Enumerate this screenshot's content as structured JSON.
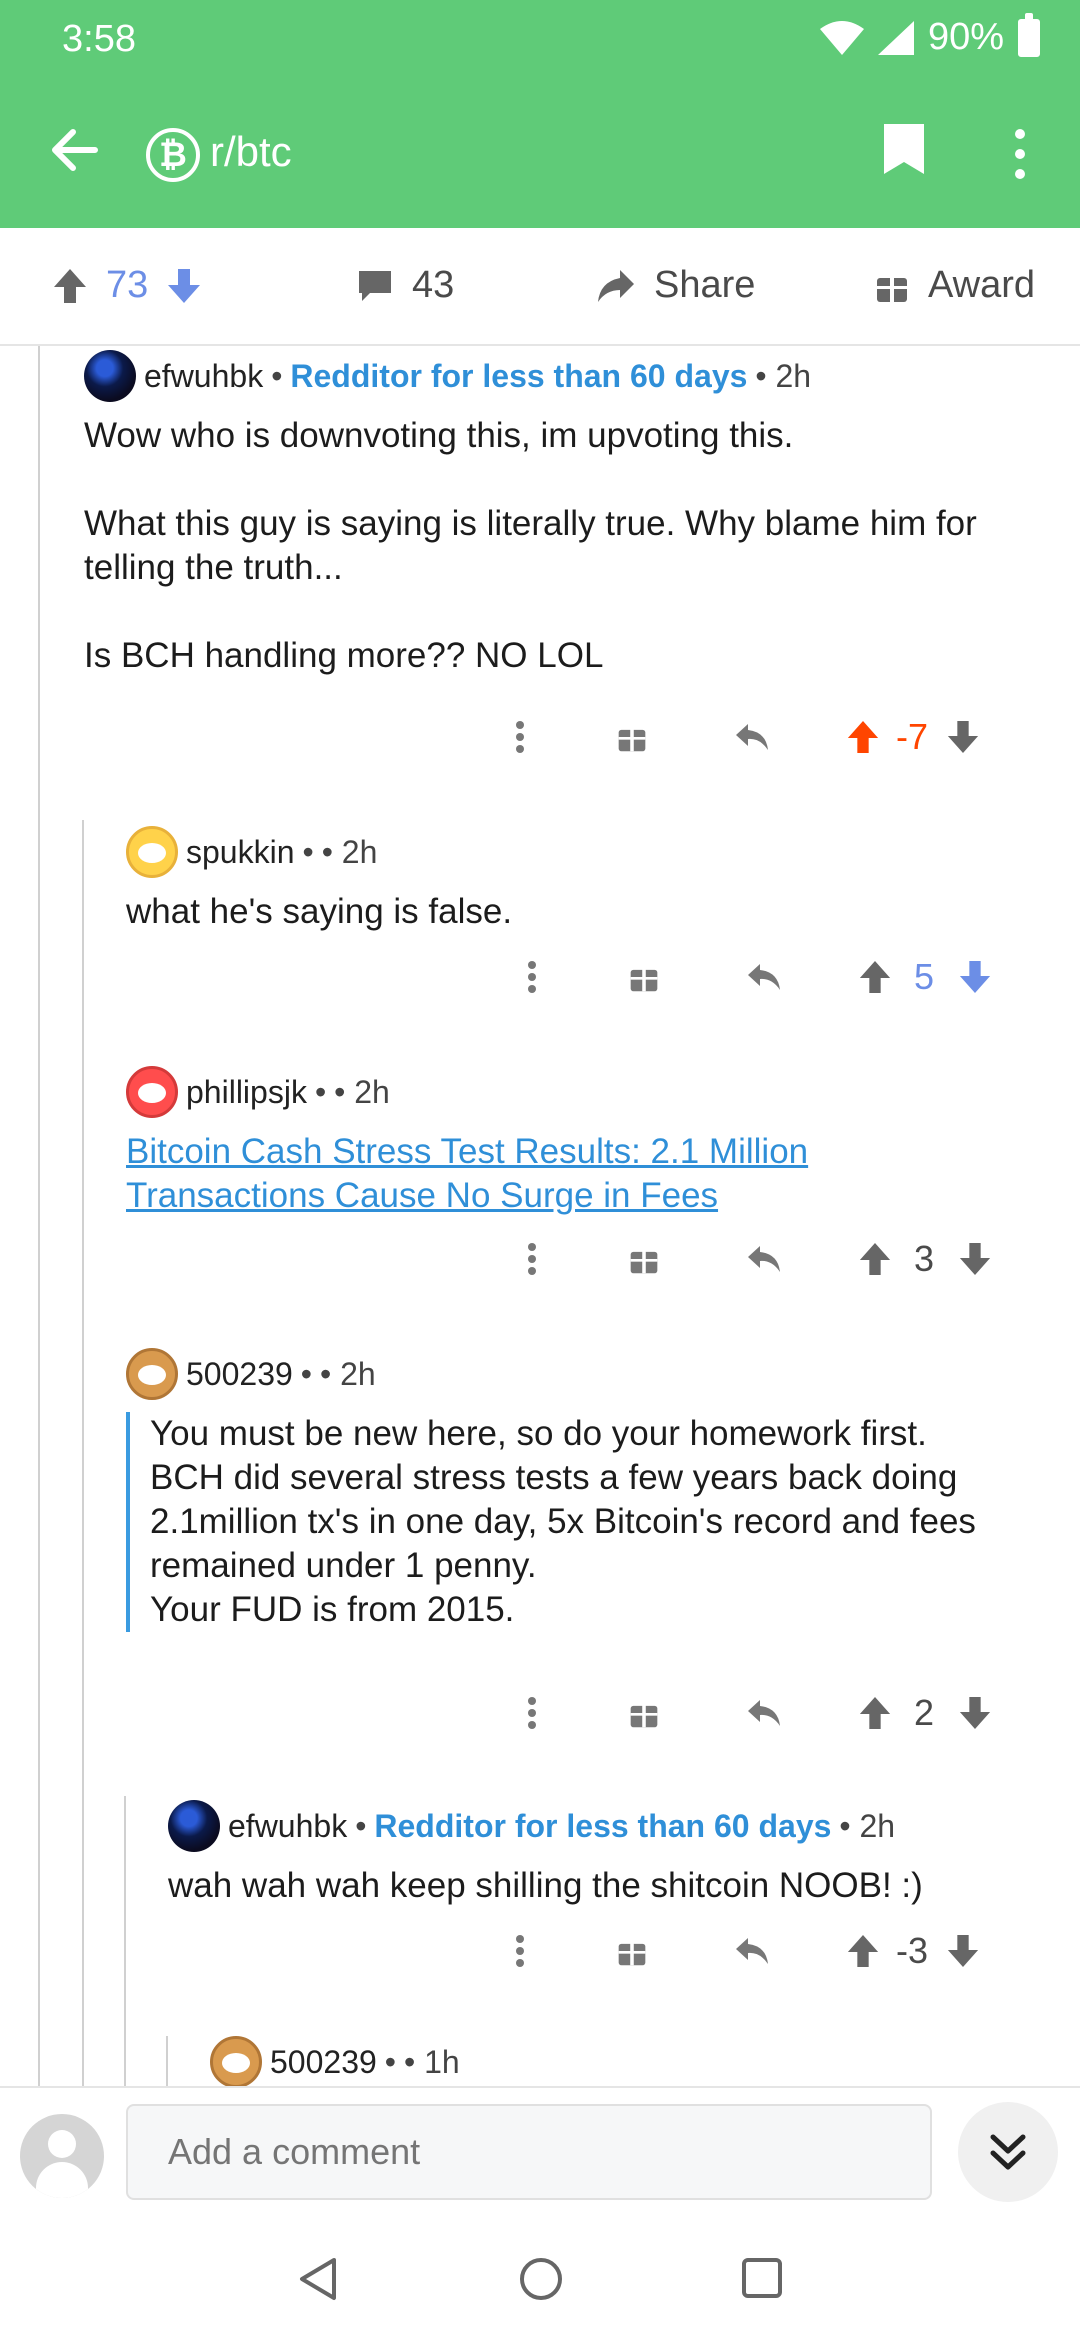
{
  "status_bar": {
    "time": "3:58",
    "battery": "90%"
  },
  "app_bar": {
    "subreddit_icon": "bitcoin-icon",
    "subreddit_icon_glyph": "₿",
    "subreddit": "r/btc"
  },
  "post_actions": {
    "votes": "73",
    "comments": "43",
    "share": "Share",
    "award": "Award"
  },
  "comments": [
    {
      "user": "efwuhbk",
      "sep": "•",
      "flair": "Redditor for less than 60 days",
      "age": "• 2h",
      "paragraphs": [
        "Wow who is downvoting this, im upvoting this.",
        "What this guy is saying is literally true. Why blame him for telling the truth...",
        "Is BCH handling more?? NO LOL"
      ],
      "score": "-7"
    },
    {
      "user": "spukkin",
      "sep": "•",
      "age": "• 2h",
      "text": "what he's saying is false.",
      "score": "5"
    },
    {
      "user": "phillipsjk",
      "sep": "•",
      "age": "• 2h",
      "link_text": "Bitcoin Cash Stress Test Results: 2.1 Million Transactions Cause No Surge in Fees",
      "score": "3"
    },
    {
      "user": "500239",
      "sep": "•",
      "age": "• 2h",
      "quote_lines": [
        "You must be new here, so do your homework first.",
        "BCH did several stress tests a few years back doing 2.1million tx's in one day, 5x Bitcoin's record and fees remained under 1 penny.",
        "Your FUD is from 2015."
      ],
      "score": "2"
    },
    {
      "user": "efwuhbk",
      "sep": "•",
      "flair": "Redditor for less than 60 days",
      "age": "• 2h",
      "text": "wah wah wah keep shilling the shitcoin NOOB! :)",
      "score": "-3"
    },
    {
      "user": "500239",
      "sep": "•",
      "age": "• 1h"
    }
  ],
  "comment_box": {
    "placeholder": "Add a comment"
  },
  "colors": {
    "header": "#5fcb78",
    "upvote_active": "#ff4500",
    "downvote_active": "#6c8ee6",
    "link": "#2f8fd8"
  }
}
